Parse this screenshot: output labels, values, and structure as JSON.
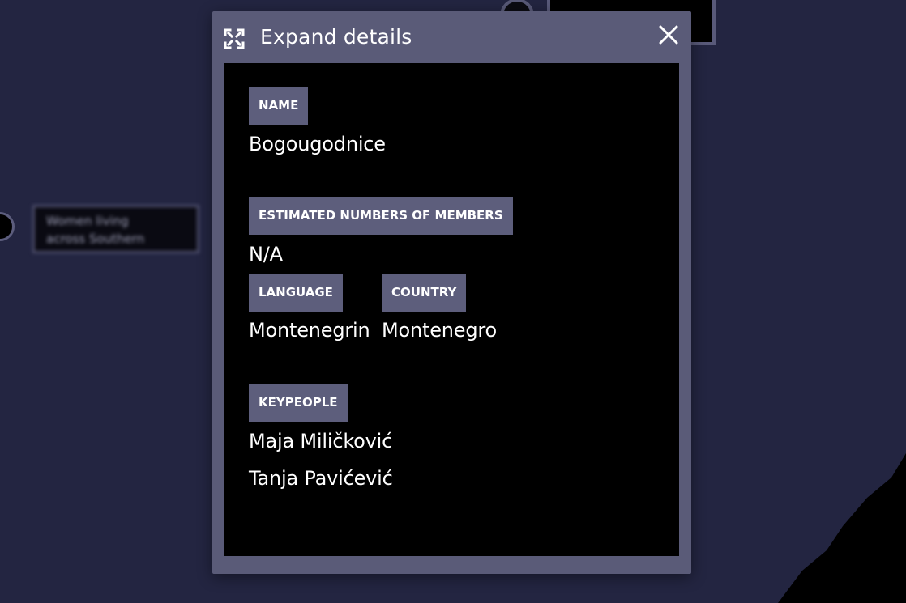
{
  "modal": {
    "title": "Expand details",
    "expand_icon": "expand-icon",
    "close_icon": "close-icon"
  },
  "details": {
    "name_label": "NAME",
    "name_value": "Bogougodnice",
    "members_label": "ESTIMATED NUMBERS OF MEMBERS",
    "members_value": "N/A",
    "language_label": "LANGUAGE",
    "language_value": "Montenegrin",
    "country_label": "COUNTRY",
    "country_value": "Montenegro",
    "keypeople_label": "KEYPEOPLE",
    "keypeople": [
      "Maja Miličković",
      "Tanja Pavićević"
    ]
  },
  "background": {
    "blurred_node_text": [
      "Women living",
      "across Southern"
    ]
  },
  "colors": {
    "canvas_bg": "#232541",
    "modal_frame": "#5a5b78",
    "modal_body": "#000000",
    "label_chip": "#5d5e7c",
    "text": "#ffffff"
  }
}
